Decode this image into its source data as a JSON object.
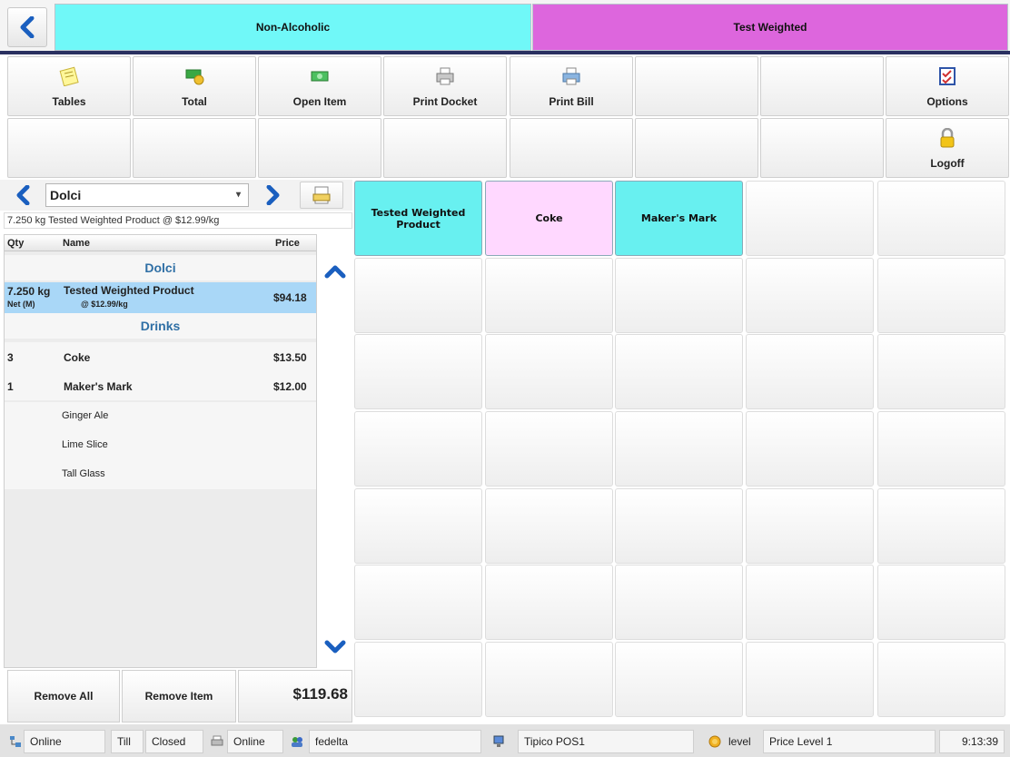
{
  "categories": [
    {
      "label": "Non-Alcoholic",
      "color": "#70f8f8"
    },
    {
      "label": "Test Weighted",
      "color": "#dd66dd"
    }
  ],
  "toolbar": {
    "tables": "Tables",
    "total": "Total",
    "open_item": "Open Item",
    "print_docket": "Print Docket",
    "print_bill": "Print Bill",
    "options": "Options",
    "logoff": "Logoff"
  },
  "order": {
    "group": "Dolci",
    "info_line": "7.250 kg Tested Weighted Product  @ $12.99/kg",
    "columns": {
      "qty": "Qty",
      "name": "Name",
      "price": "Price"
    },
    "groups": {
      "dolci": "Dolci",
      "drinks": "Drinks"
    },
    "weighted_item": {
      "qty": "7.250 kg",
      "qty_sub": "Net (M)",
      "name": "Tested Weighted Product",
      "unit_price": "@ $12.99/kg",
      "price": "$94.18"
    },
    "items": [
      {
        "qty": "3",
        "name": "Coke",
        "price": "$13.50"
      },
      {
        "qty": "1",
        "name": "Maker's Mark",
        "price": "$12.00"
      }
    ],
    "modifiers": [
      "Ginger Ale",
      "Lime Slice",
      "Tall Glass"
    ]
  },
  "actions": {
    "remove_all": "Remove All",
    "remove_item": "Remove Item",
    "total": "$119.68"
  },
  "products": [
    {
      "label": "Tested Weighted Product",
      "color": "#68f0f0"
    },
    {
      "label": "Coke",
      "color": "#ffd8ff"
    },
    {
      "label": "Maker's Mark",
      "color": "#68f0f0"
    }
  ],
  "status": {
    "connection": "Online",
    "till_label": "Till",
    "till_state": "Closed",
    "printer": "Online",
    "user": "fedelta",
    "terminal": "Tipico POS1",
    "level_label": "level",
    "price_level": "Price Level 1",
    "time": "9:13:39"
  }
}
